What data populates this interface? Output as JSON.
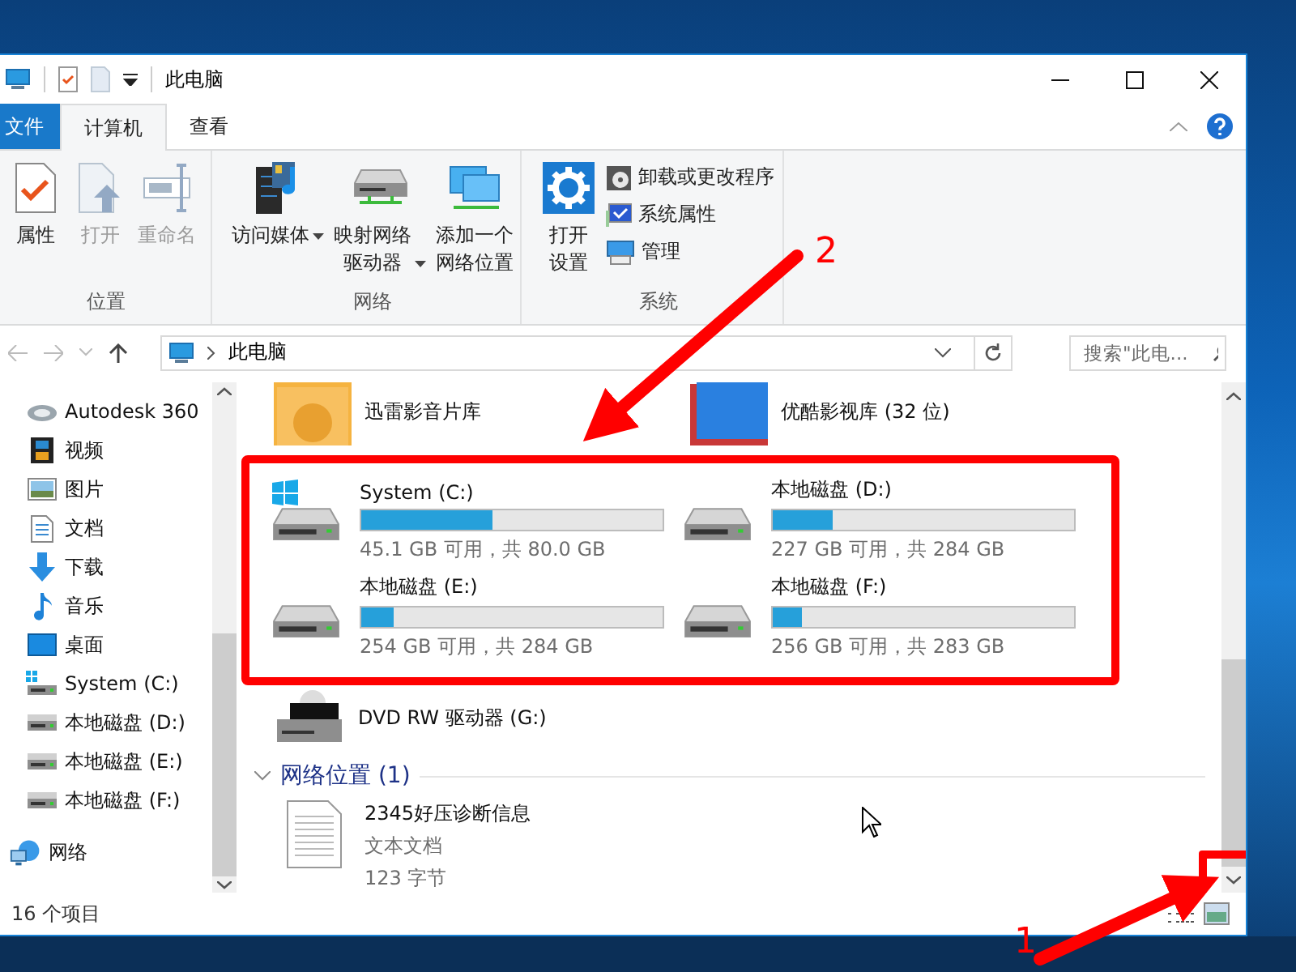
{
  "window": {
    "title": "此电脑"
  },
  "ribbon": {
    "tabs": [
      {
        "label": "文件",
        "kind": "file",
        "selected": false
      },
      {
        "label": "计算机",
        "kind": "tab",
        "selected": true
      },
      {
        "label": "查看",
        "kind": "tab",
        "selected": false
      }
    ],
    "groups": [
      {
        "label": "位置",
        "buttons": [
          {
            "kind": "properties",
            "lines": [
              "属性"
            ],
            "disabled": false,
            "dropdown": false
          },
          {
            "kind": "open",
            "lines": [
              "打开"
            ],
            "disabled": true,
            "dropdown": false
          },
          {
            "kind": "rename",
            "lines": [
              "重命名"
            ],
            "disabled": true,
            "dropdown": false
          }
        ]
      },
      {
        "label": "网络",
        "buttons": [
          {
            "kind": "media",
            "lines": [
              "访问媒体"
            ],
            "disabled": false,
            "dropdown": true
          },
          {
            "kind": "mapdrive",
            "lines": [
              "映射网络",
              "驱动器"
            ],
            "disabled": false,
            "dropdown": true
          },
          {
            "kind": "netlocation",
            "lines": [
              "添加一个",
              "网络位置"
            ],
            "disabled": false,
            "dropdown": false
          }
        ]
      },
      {
        "label": "系统",
        "buttons": [
          {
            "kind": "settings",
            "lines": [
              "打开",
              "设置"
            ],
            "disabled": false,
            "dropdown": false
          }
        ],
        "small_buttons": [
          {
            "kind": "uninstall",
            "label": "卸载或更改程序"
          },
          {
            "kind": "sysprops",
            "label": "系统属性"
          },
          {
            "kind": "manage",
            "label": "管理"
          }
        ]
      }
    ]
  },
  "address_bar": {
    "path": "此电脑",
    "search_placeholder": "搜索\"此电..."
  },
  "nav_pane": {
    "items": [
      {
        "kind": "cloud",
        "label": "Autodesk 360"
      },
      {
        "kind": "video",
        "label": "视频"
      },
      {
        "kind": "picture",
        "label": "图片"
      },
      {
        "kind": "document",
        "label": "文档"
      },
      {
        "kind": "download",
        "label": "下载"
      },
      {
        "kind": "music",
        "label": "音乐"
      },
      {
        "kind": "desktop",
        "label": "桌面"
      },
      {
        "kind": "sysdrive",
        "label": "System (C:)"
      },
      {
        "kind": "drive",
        "label": "本地磁盘 (D:)"
      },
      {
        "kind": "drive",
        "label": "本地磁盘 (E:)"
      },
      {
        "kind": "drive",
        "label": "本地磁盘 (F:)"
      },
      {
        "kind": "network",
        "label": "网络"
      }
    ]
  },
  "content": {
    "folders": [
      {
        "kind": "xunlei",
        "name": "迅雷影音片库"
      },
      {
        "kind": "youku",
        "name": "优酷影视库 (32 位)"
      }
    ],
    "drives_highlighted": true,
    "drives": [
      {
        "kind": "system",
        "name": "System (C:)",
        "level": 0.436,
        "space": "45.1 GB 可用，共 80.0 GB"
      },
      {
        "kind": "local",
        "name": "本地磁盘 (D:)",
        "level": 0.2,
        "space": "227 GB 可用，共 284 GB"
      },
      {
        "kind": "local",
        "name": "本地磁盘 (E:)",
        "level": 0.106,
        "space": "254 GB 可用，共 284 GB"
      },
      {
        "kind": "local",
        "name": "本地磁盘 (F:)",
        "level": 0.095,
        "space": "256 GB 可用，共 283 GB"
      }
    ],
    "optical_drive": {
      "name": "DVD RW 驱动器 (G:)"
    },
    "network_group": {
      "title": "网络位置 (1)",
      "expanded": true,
      "items": [
        {
          "name": "2345好压诊断信息",
          "type": "文本文档",
          "size": "123 字节"
        }
      ]
    },
    "scroll_down_highlighted": true
  },
  "status_bar": {
    "item_count": "16 个项目"
  },
  "annotations": [
    {
      "label": "2"
    },
    {
      "label": "1"
    }
  ]
}
